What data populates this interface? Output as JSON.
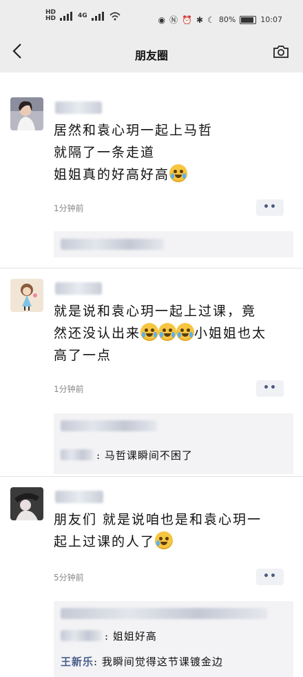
{
  "status_bar": {
    "net1": "HD",
    "net2": "HD",
    "signal1": "4G",
    "signal2": "4G",
    "battery": "80%",
    "time": "10:07"
  },
  "nav": {
    "title": "朋友圈"
  },
  "posts": [
    {
      "lines": [
        "居然和袁心玥一起上马哲",
        "就隔了一条走道",
        "姐姐真的好高好高"
      ],
      "time": "1分钟前",
      "more": "••"
    },
    {
      "lines": [
        "就是说和袁心玥一起上过课，竟",
        "然还没认出来",
        "小姐姐也太",
        "高了一点"
      ],
      "time": "1分钟前",
      "more": "••",
      "comment_text": ": 马哲课瞬间不困了"
    },
    {
      "lines": [
        "朋友们 就是说咱也是和袁心玥一",
        "起上过课的人了"
      ],
      "time": "5分钟前",
      "more": "••",
      "comment1_text": ": 姐姐好高",
      "comment2_name": "王新乐",
      "comment2_text": ": 我瞬间觉得这节课镀金边"
    }
  ],
  "colors": {
    "header_bg": "#ededed",
    "comment_name": "#4a5f8c",
    "emoji": "#f6c541"
  }
}
